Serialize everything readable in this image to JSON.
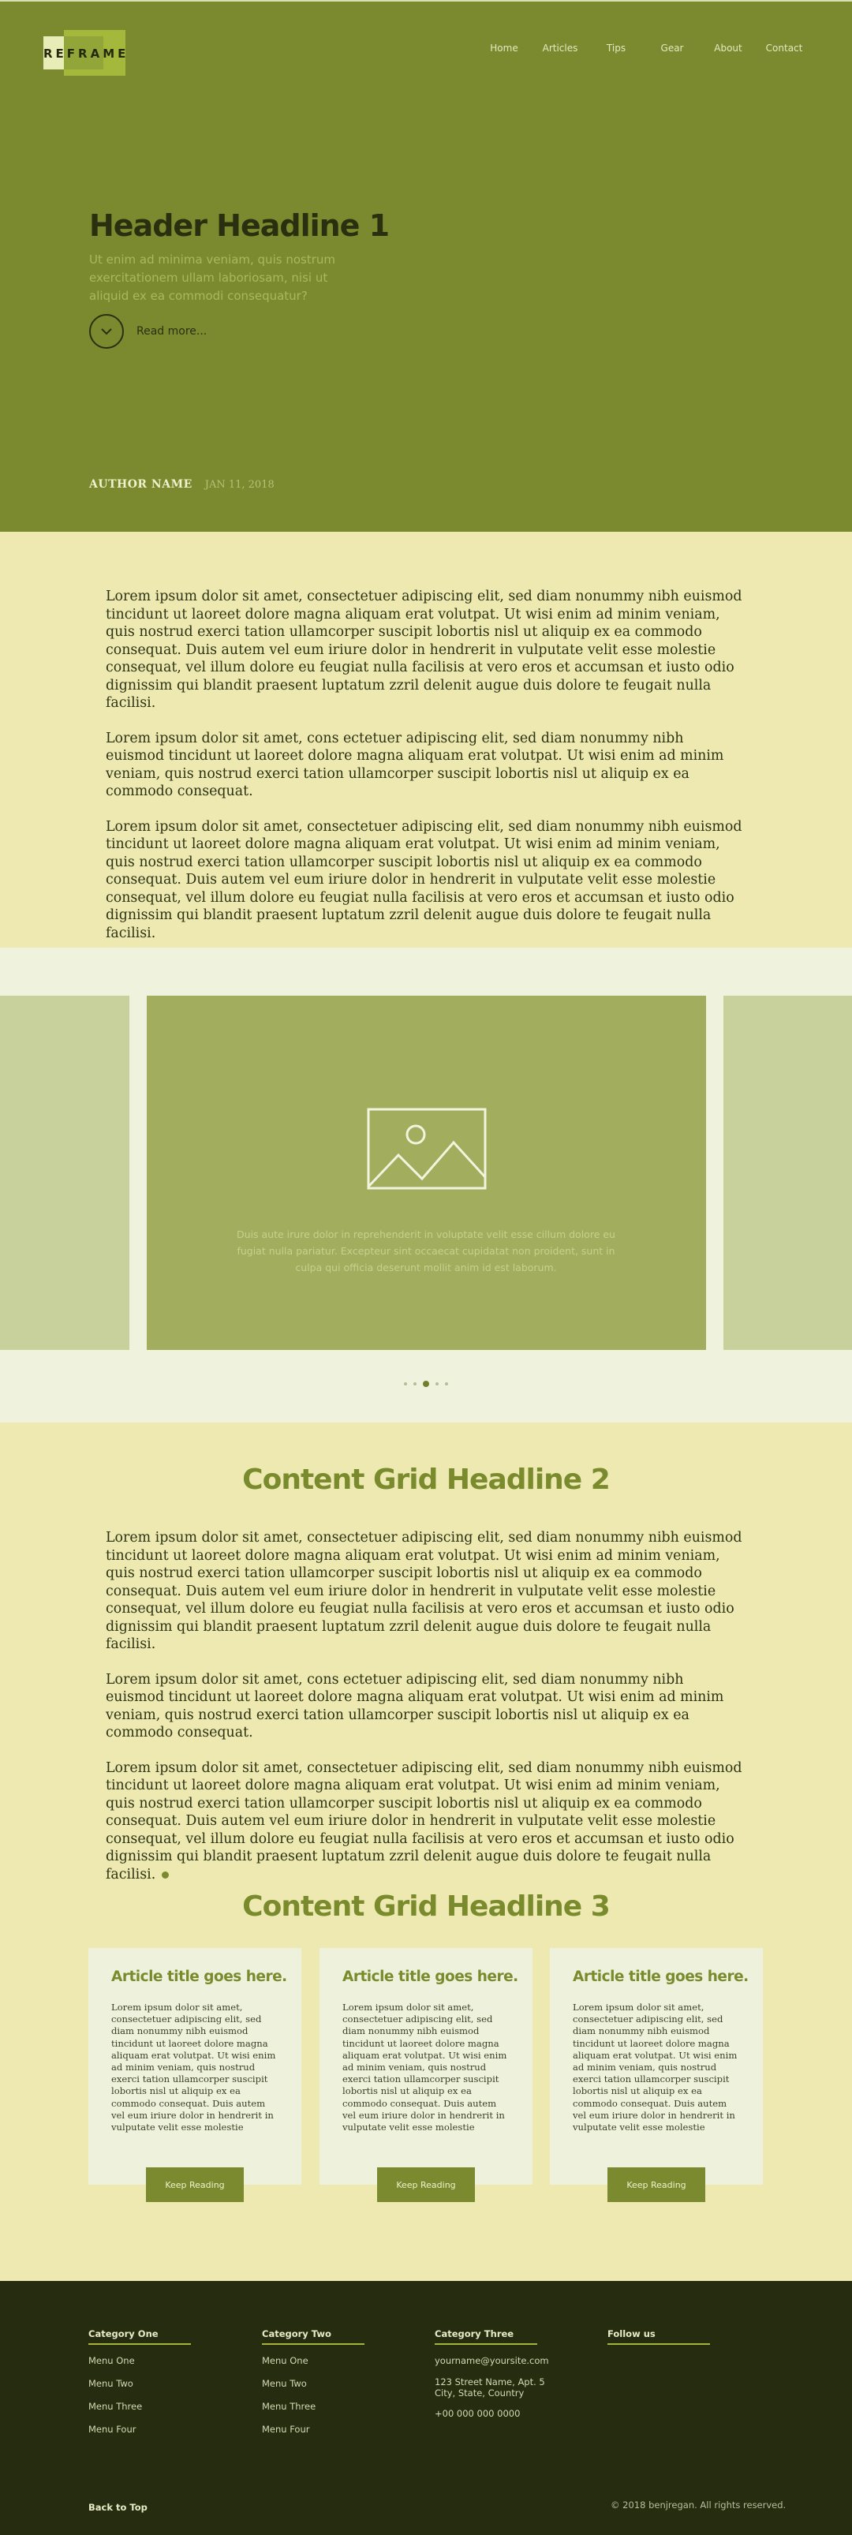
{
  "brand": {
    "logo_text": "REFRAME"
  },
  "nav": [
    {
      "label": "Home"
    },
    {
      "label": "Articles"
    },
    {
      "label": "Tips"
    },
    {
      "label": "Gear"
    },
    {
      "label": "About"
    },
    {
      "label": "Contact"
    }
  ],
  "hero": {
    "title": "Header Headline 1",
    "subtitle": "Ut enim ad minima veniam, quis nostrum exercitationem ullam laboriosam, nisi ut aliquid ex ea commodi consequatur?",
    "read_more": "Read more...",
    "author": "AUTHOR NAME",
    "date": "JAN 11, 2018"
  },
  "intro_paragraphs": [
    "Lorem ipsum dolor sit amet, consectetuer adipiscing elit, sed diam nonummy nibh euismod tincidunt ut laoreet dolore magna aliquam erat volutpat. Ut wisi enim ad minim veniam, quis nostrud exerci tation ullamcorper suscipit lobortis nisl ut aliquip ex ea commodo consequat. Duis autem vel eum iriure dolor in hendrerit in vulputate velit esse molestie consequat, vel illum dolore eu feugiat nulla facilisis at vero eros et accumsan et iusto odio dignissim qui blandit praesent luptatum zzril delenit augue duis dolore te feugait nulla facilisi.",
    "Lorem ipsum dolor sit amet, cons ectetuer adipiscing elit, sed diam nonummy nibh euismod tincidunt ut laoreet dolore magna aliquam erat volutpat. Ut wisi enim ad minim veniam, quis nostrud exerci tation ullamcorper suscipit lobortis nisl ut aliquip ex ea commodo consequat.",
    "Lorem ipsum dolor sit amet, consectetuer adipiscing elit, sed diam nonummy nibh euismod tincidunt ut laoreet dolore magna aliquam erat volutpat. Ut wisi enim ad minim veniam, quis nostrud exerci tation ullamcorper suscipit lobortis nisl ut aliquip ex ea commodo consequat. Duis autem vel eum iriure dolor in hendrerit in vulputate velit esse molestie consequat, vel illum dolore eu feugiat nulla facilisis at vero eros et accumsan et iusto odio dignissim qui blandit praesent luptatum zzril delenit augue duis dolore te feugait nulla facilisi."
  ],
  "carousel": {
    "caption": "Duis aute irure dolor in reprehenderit in voluptate velit esse cillum dolore eu fugiat nulla pariatur. Excepteur sint occaecat cupidatat non proident, sunt in culpa qui officia deserunt mollit anim id est laborum.",
    "slide_count": 5,
    "active_index": 2
  },
  "section2": {
    "headline": "Content Grid Headline 2",
    "paragraphs": [
      "Lorem ipsum dolor sit amet, consectetuer adipiscing elit, sed diam nonummy nibh euismod tincidunt ut laoreet dolore magna aliquam erat volutpat. Ut wisi enim ad minim veniam, quis nostrud exerci tation ullamcorper suscipit lobortis nisl ut aliquip ex ea commodo consequat. Duis autem vel eum iriure dolor in hendrerit in vulputate velit esse molestie consequat, vel illum dolore eu feugiat nulla facilisis at vero eros et accumsan et iusto odio dignissim qui blandit praesent luptatum zzril delenit augue duis dolore te feugait nulla facilisi.",
      "Lorem ipsum dolor sit amet, cons ectetuer adipiscing elit, sed diam nonummy nibh euismod tincidunt ut laoreet dolore magna aliquam erat volutpat. Ut wisi enim ad minim veniam, quis nostrud exerci tation ullamcorper suscipit lobortis nisl ut aliquip ex ea commodo consequat.",
      "Lorem ipsum dolor sit amet, consectetuer adipiscing elit, sed diam nonummy nibh euismod tincidunt ut laoreet dolore magna aliquam erat volutpat. Ut wisi enim ad minim veniam, quis nostrud exerci tation ullamcorper suscipit lobortis nisl ut aliquip ex ea commodo consequat. Duis autem vel eum iriure dolor in hendrerit in vulputate velit esse molestie consequat, vel illum dolore eu feugiat nulla facilisis at vero eros et accumsan et iusto odio dignissim qui blandit praesent luptatum zzril delenit augue duis dolore te feugait nulla facilisi."
    ]
  },
  "section3": {
    "headline": "Content Grid Headline 3",
    "cards": [
      {
        "title": "Article title goes here.",
        "body": "Lorem ipsum dolor sit amet, consectetuer adipiscing elit, sed diam nonummy nibh euismod tincidunt ut laoreet dolore magna aliquam erat volutpat. Ut wisi enim ad minim veniam, quis nostrud exerci tation ullamcorper suscipit lobortis nisl ut aliquip ex ea commodo consequat. Duis autem vel eum iriure dolor in hendrerit in vulputate velit esse molestie",
        "button": "Keep Reading"
      },
      {
        "title": "Article title goes here.",
        "body": "Lorem ipsum dolor sit amet, consectetuer adipiscing elit, sed diam nonummy nibh euismod tincidunt ut laoreet dolore magna aliquam erat volutpat. Ut wisi enim ad minim veniam, quis nostrud exerci tation ullamcorper suscipit lobortis nisl ut aliquip ex ea commodo consequat. Duis autem vel eum iriure dolor in hendrerit in vulputate velit esse molestie",
        "button": "Keep Reading"
      },
      {
        "title": "Article title goes here.",
        "body": "Lorem ipsum dolor sit amet, consectetuer adipiscing elit, sed diam nonummy nibh euismod tincidunt ut laoreet dolore magna aliquam erat volutpat. Ut wisi enim ad minim veniam, quis nostrud exerci tation ullamcorper suscipit lobortis nisl ut aliquip ex ea commodo consequat. Duis autem vel eum iriure dolor in hendrerit in vulputate velit esse molestie",
        "button": "Keep Reading"
      }
    ]
  },
  "footer": {
    "columns": [
      {
        "heading": "Category One",
        "links": [
          "Menu One",
          "Menu Two",
          "Menu Three",
          "Menu Four"
        ]
      },
      {
        "heading": "Category Two",
        "links": [
          "Menu One",
          "Menu Two",
          "Menu Three",
          "Menu Four"
        ]
      },
      {
        "heading": "Category Three",
        "email": "yourname@yoursite.com",
        "address_line1": "123 Street Name, Apt. 5",
        "address_line2": "City, State, Country",
        "phone": "+00 000 000 0000"
      },
      {
        "heading": "Follow us"
      }
    ],
    "back_to_top": "Back to Top",
    "copyright": "© 2018 benjregan. All rights reserved."
  },
  "colors": {
    "hero_bg": "#7b8a2e",
    "page_bg": "#ede9b0",
    "accent": "#7a8b2d",
    "footer_bg": "#262c0f"
  }
}
